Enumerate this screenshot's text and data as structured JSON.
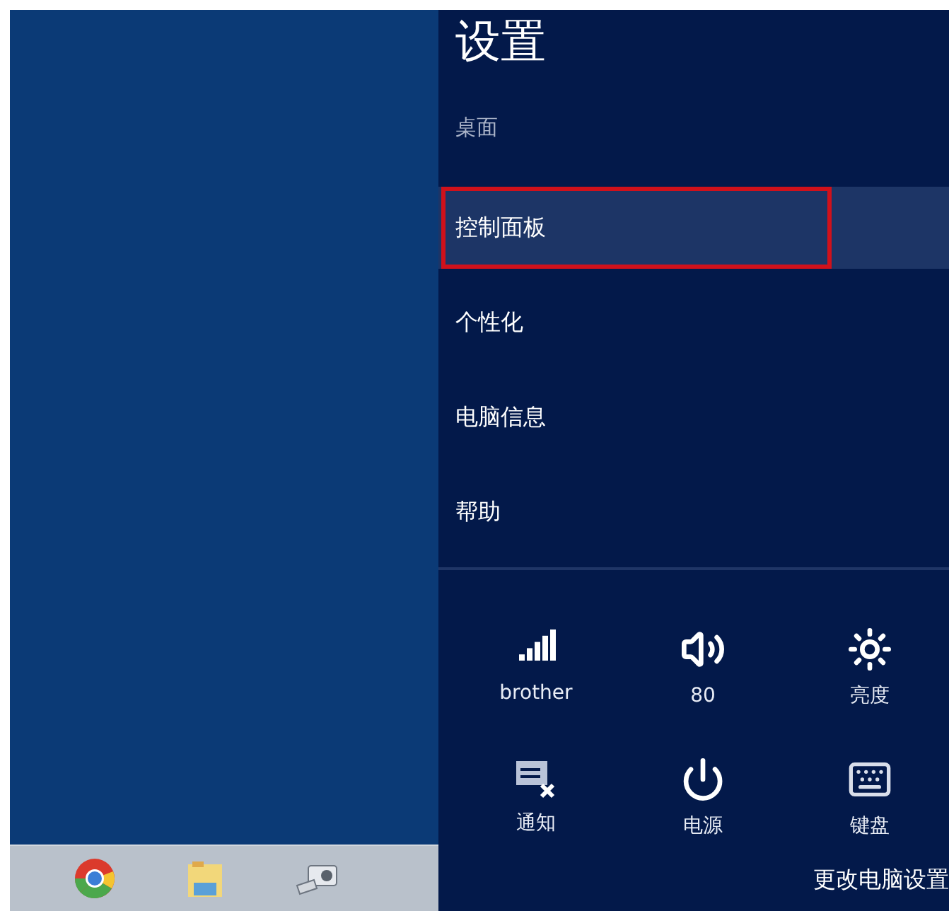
{
  "settings_pane": {
    "title": "设置",
    "subtitle": "桌面",
    "items": [
      {
        "label": "控制面板",
        "selected": true
      },
      {
        "label": "个性化",
        "selected": false
      },
      {
        "label": "电脑信息",
        "selected": false
      },
      {
        "label": "帮助",
        "selected": false
      }
    ],
    "quick_settings": [
      {
        "kind": "signal",
        "label": "brother"
      },
      {
        "kind": "volume",
        "label": "80"
      },
      {
        "kind": "brightness",
        "label": "亮度"
      },
      {
        "kind": "notifications",
        "label": "通知"
      },
      {
        "kind": "power",
        "label": "电源"
      },
      {
        "kind": "keyboard",
        "label": "键盘"
      }
    ],
    "footer_link": "更改电脑设置"
  }
}
